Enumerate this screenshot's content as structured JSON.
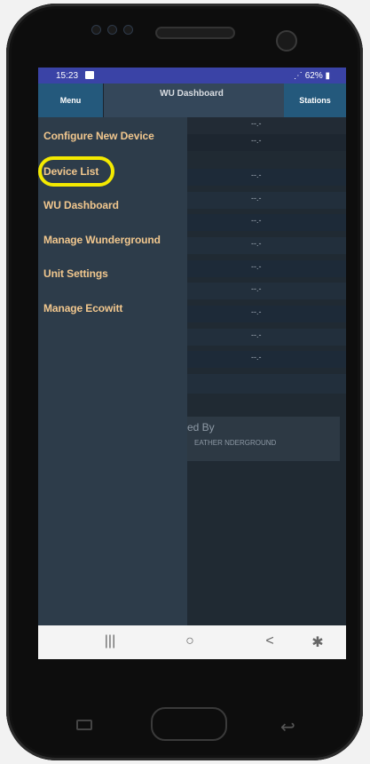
{
  "status_bar": {
    "time": "15:23",
    "right": "62%"
  },
  "app_bar": {
    "menu_label": "Menu",
    "title": "WU Dashboard",
    "stations_label": "Stations"
  },
  "drawer": {
    "items": [
      {
        "label": "Configure New Device"
      },
      {
        "label": "Device List"
      },
      {
        "label": "WU Dashboard"
      },
      {
        "label": "Manage Wunderground"
      },
      {
        "label": "Unit Settings"
      },
      {
        "label": "Manage Ecowitt"
      }
    ],
    "highlighted_item": "Device List"
  },
  "dashboard": {
    "rows": [
      {
        "value": "--.-"
      },
      {
        "value": "--.-"
      },
      {
        "value": "--.-"
      },
      {
        "value": "--.-"
      },
      {
        "value": "--.-"
      },
      {
        "value": "--.-"
      },
      {
        "value": "--.-"
      },
      {
        "value": "--.-"
      },
      {
        "value": "--.-"
      },
      {
        "value": "--.-"
      },
      {
        "value": "--.-"
      }
    ],
    "powered_by": "red By",
    "powered_brand": "EATHER NDERGROUND"
  },
  "nav_bar": {
    "recents": "|||",
    "home": "○",
    "back": "<",
    "accessibility": "✱"
  },
  "colors": {
    "status_bar": "#3a43a6",
    "app_bar": "#34475a",
    "drawer": "#2d3c4a",
    "drawer_text": "#f1c78e",
    "highlight": "#f4ea00"
  }
}
